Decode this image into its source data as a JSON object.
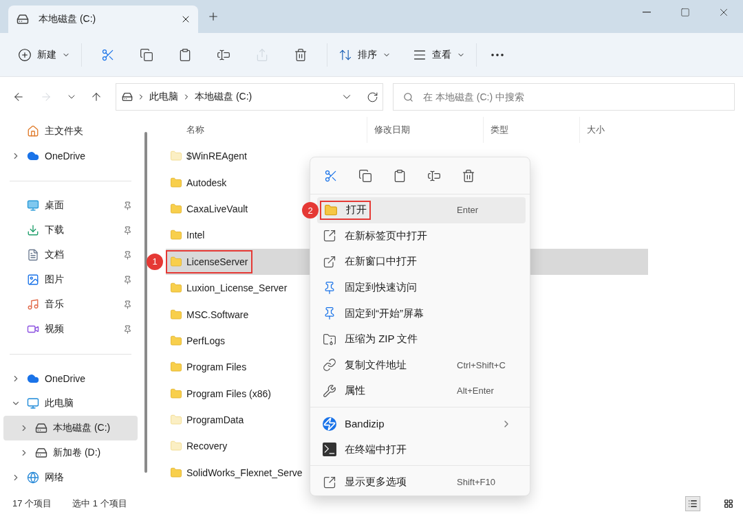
{
  "window": {
    "tab_title": "本地磁盘 (C:)"
  },
  "toolbar": {
    "new_label": "新建",
    "actions": [
      {
        "kind": "cut",
        "disabled": false
      },
      {
        "kind": "copy",
        "disabled": false
      },
      {
        "kind": "paste",
        "disabled": false
      },
      {
        "kind": "rename",
        "disabled": false
      },
      {
        "kind": "share",
        "disabled": true
      },
      {
        "kind": "delete",
        "disabled": false
      }
    ],
    "sort_label": "排序",
    "view_label": "查看"
  },
  "address": {
    "crumbs": [
      "此电脑",
      "本地磁盘 (C:)"
    ]
  },
  "search": {
    "placeholder": "在 本地磁盘 (C:) 中搜索"
  },
  "sidebar": {
    "sections": [
      [
        {
          "kind": "home",
          "label": "主文件夹",
          "selected": false
        },
        {
          "kind": "cloud",
          "label": "OneDrive",
          "expanded": false,
          "selected": false
        }
      ],
      [
        {
          "kind": "desktop",
          "label": "桌面",
          "pinned": true,
          "selected": false
        },
        {
          "kind": "download",
          "label": "下载",
          "pinned": true,
          "selected": false
        },
        {
          "kind": "document",
          "label": "文档",
          "pinned": true,
          "selected": false
        },
        {
          "kind": "picture",
          "label": "图片",
          "pinned": true,
          "selected": false
        },
        {
          "kind": "music",
          "label": "音乐",
          "pinned": true,
          "selected": false
        },
        {
          "kind": "video",
          "label": "视频",
          "pinned": true,
          "selected": false
        }
      ],
      [
        {
          "kind": "cloud",
          "label": "OneDrive",
          "expanded": false,
          "selected": false
        },
        {
          "kind": "pc",
          "label": "此电脑",
          "expanded": true,
          "selected": false,
          "children": [
            {
              "kind": "drive",
              "label": "本地磁盘 (C:)",
              "expanded": false,
              "selected": true
            },
            {
              "kind": "drive",
              "label": "新加卷 (D:)",
              "expanded": false,
              "selected": false
            }
          ]
        },
        {
          "kind": "network",
          "label": "网络",
          "expanded": false,
          "selected": false
        }
      ]
    ]
  },
  "files": {
    "columns": [
      "名称",
      "修改日期",
      "类型",
      "大小"
    ],
    "rows": [
      {
        "name": "$WinREAgent",
        "hidden": true,
        "selected": false
      },
      {
        "name": "Autodesk",
        "hidden": false,
        "selected": false
      },
      {
        "name": "CaxaLiveVault",
        "hidden": false,
        "selected": false
      },
      {
        "name": "Intel",
        "hidden": false,
        "selected": false
      },
      {
        "name": "LicenseServer",
        "hidden": false,
        "selected": true,
        "badge": "1"
      },
      {
        "name": "Luxion_License_Server",
        "hidden": false,
        "selected": false
      },
      {
        "name": "MSC.Software",
        "hidden": false,
        "selected": false
      },
      {
        "name": "PerfLogs",
        "hidden": false,
        "selected": false
      },
      {
        "name": "Program Files",
        "hidden": false,
        "selected": false
      },
      {
        "name": "Program Files (x86)",
        "hidden": false,
        "selected": false
      },
      {
        "name": "ProgramData",
        "hidden": true,
        "selected": false
      },
      {
        "name": "Recovery",
        "hidden": true,
        "selected": false
      },
      {
        "name": "SolidWorks_Flexnet_Serve",
        "hidden": false,
        "selected": false
      }
    ]
  },
  "context_menu": {
    "quick_actions": [
      {
        "kind": "cut"
      },
      {
        "kind": "copy"
      },
      {
        "kind": "paste"
      },
      {
        "kind": "rename"
      },
      {
        "kind": "delete"
      }
    ],
    "items": [
      {
        "kind": "open",
        "label": "打开",
        "shortcut": "Enter",
        "highlighted": true,
        "submenu": false,
        "badge": "2"
      },
      {
        "kind": "new-tab",
        "label": "在新标签页中打开",
        "highlighted": false,
        "submenu": false
      },
      {
        "kind": "new-window",
        "label": "在新窗口中打开",
        "highlighted": false,
        "submenu": false
      },
      {
        "kind": "pin",
        "label": "固定到快速访问",
        "highlighted": false,
        "submenu": false
      },
      {
        "kind": "pin",
        "label": "固定到“开始”屏幕",
        "highlighted": false,
        "submenu": false
      },
      {
        "kind": "zip",
        "label": "压缩为 ZIP 文件",
        "highlighted": false,
        "submenu": false
      },
      {
        "kind": "path",
        "label": "复制文件地址",
        "shortcut": "Ctrl+Shift+C",
        "highlighted": false,
        "submenu": false
      },
      {
        "kind": "properties",
        "label": "属性",
        "shortcut": "Alt+Enter",
        "highlighted": false,
        "submenu": false
      },
      {
        "kind": "separator"
      },
      {
        "kind": "bandizip",
        "label": "Bandizip",
        "highlighted": false,
        "submenu": true
      },
      {
        "kind": "terminal",
        "label": "在终端中打开",
        "highlighted": false,
        "submenu": false
      },
      {
        "kind": "separator"
      },
      {
        "kind": "more",
        "label": "显示更多选项",
        "shortcut": "Shift+F10",
        "highlighted": false,
        "submenu": false
      }
    ]
  },
  "status_bar": {
    "count": "17 个项目",
    "selection": "选中 1 个项目",
    "view_buttons": [
      {
        "kind": "details",
        "selected": true
      },
      {
        "kind": "tiles",
        "selected": false
      }
    ]
  }
}
